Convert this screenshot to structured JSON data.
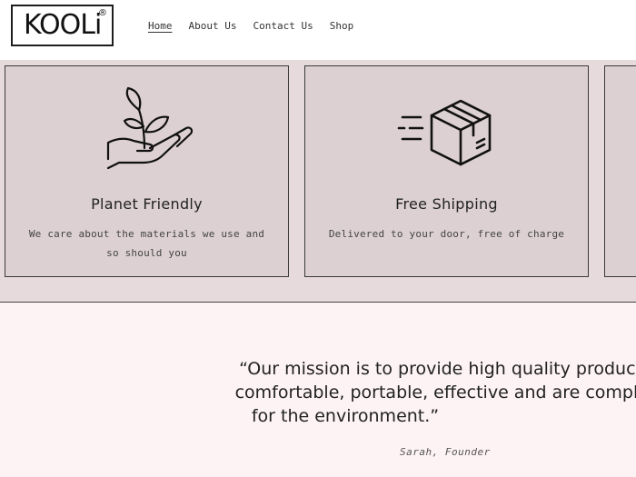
{
  "brand": {
    "logo_text": "KOOLi",
    "registered_mark": "®"
  },
  "nav": {
    "items": [
      {
        "label": "Home",
        "active": true
      },
      {
        "label": "About Us",
        "active": false
      },
      {
        "label": "Contact Us",
        "active": false
      },
      {
        "label": "Shop",
        "active": false
      }
    ]
  },
  "features": {
    "cards": [
      {
        "icon": "plant-in-hand-icon",
        "title": "Planet Friendly",
        "text_line1": "We care about the materials we use and",
        "text_line2": "so should you"
      },
      {
        "icon": "shipping-box-icon",
        "title": "Free Shipping",
        "text_line1": "Delivered to your door, free of charge",
        "text_line2": ""
      }
    ]
  },
  "quote": {
    "line1": "“Our mission is to provide high quality products",
    "line2": "comfortable, portable, effective and are complet",
    "line3": "for the environment.”",
    "author": "Sarah, Founder"
  },
  "colors": {
    "features_bg": "#e6dadd",
    "card_bg": "#dcd0d2",
    "quote_bg": "#fdf3f5",
    "text": "#1e1e1e"
  }
}
